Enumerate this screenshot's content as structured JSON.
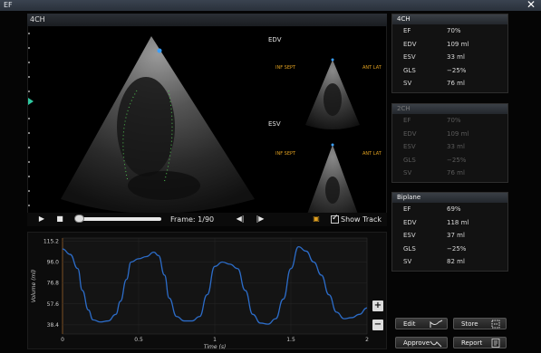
{
  "window": {
    "title": "EF",
    "close_icon": "close-icon"
  },
  "main": {
    "view_label": "4CH",
    "edv_label": "EDV",
    "esv_label": "ESV",
    "orient": {
      "inf_sept": "INF SEPT",
      "ant_lat": "ANT LAT"
    }
  },
  "playback": {
    "frame_text": "Frame: 1/90",
    "show_track_label": "Show Track",
    "show_track_checked": true,
    "icons": [
      "play-icon",
      "stop-icon",
      "step-back-icon",
      "step-forward-icon",
      "camera-icon"
    ]
  },
  "panels": [
    {
      "title": "4CH",
      "enabled": true,
      "rows": [
        {
          "k": "EF",
          "v": "70%"
        },
        {
          "k": "EDV",
          "v": "109 ml"
        },
        {
          "k": "ESV",
          "v": "33 ml"
        },
        {
          "k": "GLS",
          "v": "−25%"
        },
        {
          "k": "SV",
          "v": "76 ml"
        }
      ]
    },
    {
      "title": "2CH",
      "enabled": false,
      "rows": [
        {
          "k": "EF",
          "v": "70%"
        },
        {
          "k": "EDV",
          "v": "109 ml"
        },
        {
          "k": "ESV",
          "v": "33 ml"
        },
        {
          "k": "GLS",
          "v": "−25%"
        },
        {
          "k": "SV",
          "v": "76 ml"
        }
      ]
    },
    {
      "title": "Biplane",
      "enabled": true,
      "rows": [
        {
          "k": "EF",
          "v": "69%"
        },
        {
          "k": "EDV",
          "v": "118 ml"
        },
        {
          "k": "ESV",
          "v": "37 ml"
        },
        {
          "k": "GLS",
          "v": "−25%"
        },
        {
          "k": "SV",
          "v": "82 ml"
        }
      ]
    }
  ],
  "actions": {
    "edit": "Edit",
    "store": "Store",
    "approve": "Approve",
    "report": "Report"
  },
  "chart_data": {
    "type": "line",
    "ylabel": "Volume (ml)",
    "xlabel": "Time (s)",
    "yticks": [
      "115.2",
      "96.0",
      "76.8",
      "57.6",
      "38.4"
    ],
    "xticks": [
      "0",
      "0.5",
      "1",
      "1.5",
      "2"
    ],
    "ylim": [
      30,
      118
    ],
    "xlim": [
      0,
      2
    ],
    "series": [
      {
        "color": "#2c6cc8",
        "x": [
          0,
          0.05,
          0.1,
          0.13,
          0.17,
          0.2,
          0.25,
          0.3,
          0.35,
          0.38,
          0.42,
          0.45,
          0.5,
          0.55,
          0.6,
          0.63,
          0.67,
          0.7,
          0.75,
          0.8,
          0.85,
          0.9,
          0.95,
          1.0,
          1.05,
          1.1,
          1.15,
          1.2,
          1.25,
          1.3,
          1.35,
          1.4,
          1.45,
          1.5,
          1.55,
          1.6,
          1.65,
          1.7,
          1.75,
          1.8,
          1.85,
          1.9,
          1.95,
          2.0
        ],
        "y": [
          108,
          103,
          90,
          70,
          52,
          43,
          41,
          42,
          48,
          60,
          80,
          96,
          99,
          101,
          105,
          102,
          84,
          63,
          46,
          42,
          42,
          46,
          66,
          92,
          96,
          94,
          90,
          70,
          48,
          40,
          39,
          44,
          62,
          90,
          110,
          106,
          96,
          84,
          66,
          50,
          44,
          45,
          48,
          54
        ]
      }
    ]
  }
}
